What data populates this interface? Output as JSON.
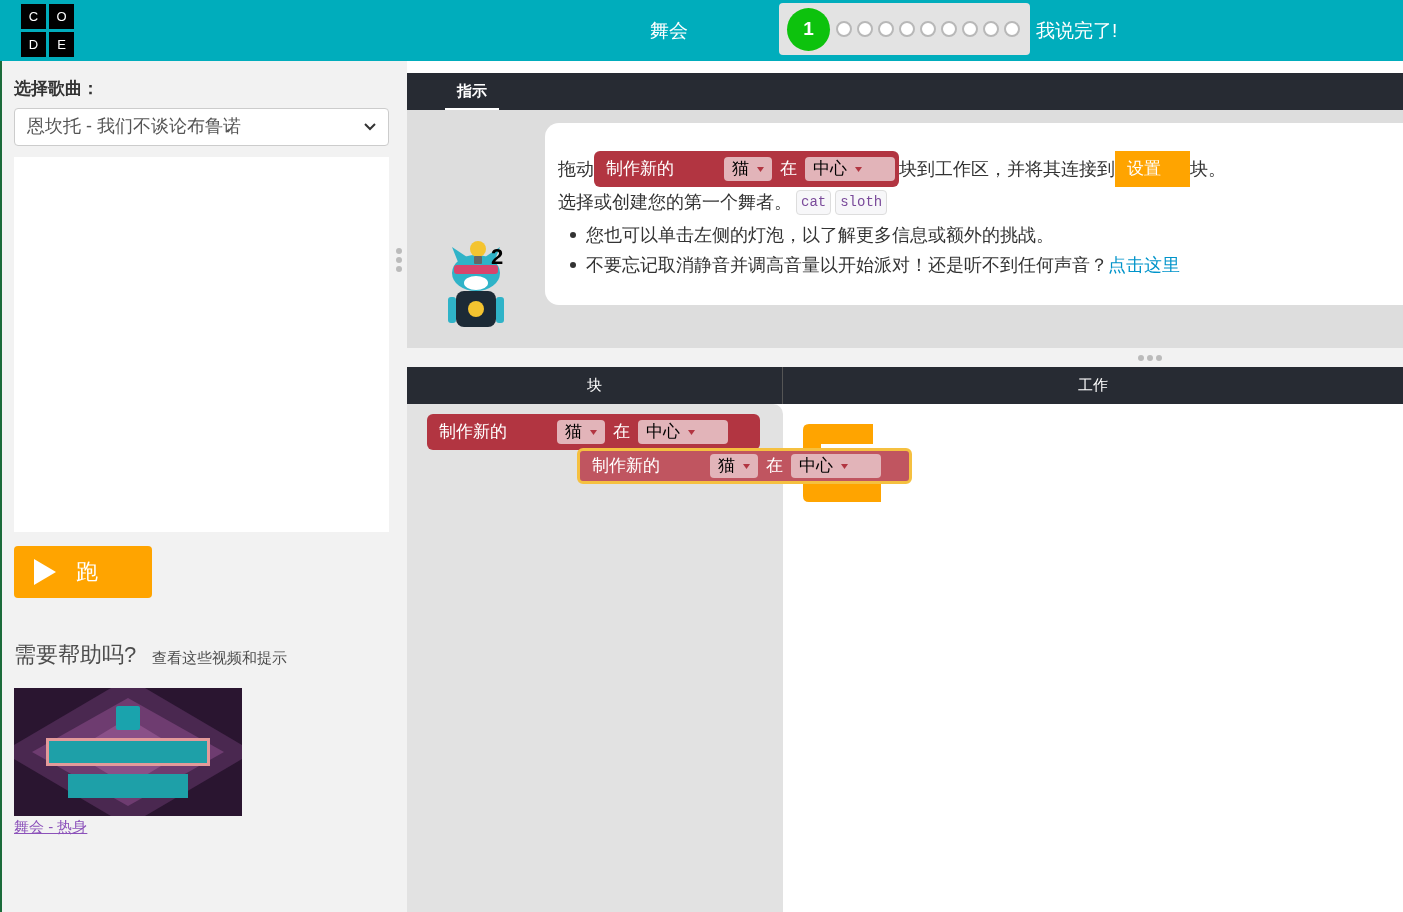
{
  "header": {
    "logo_letters": [
      "C",
      "O",
      "D",
      "E"
    ],
    "title": "舞会",
    "progress": {
      "current": "1",
      "dots": [
        {
          "completed": false
        },
        {
          "completed": false
        },
        {
          "completed": false
        },
        {
          "completed": false
        },
        {
          "completed": false
        },
        {
          "completed": false
        },
        {
          "completed": false
        },
        {
          "completed": false
        },
        {
          "completed": false
        }
      ]
    },
    "finish": "我说完了!"
  },
  "song": {
    "label": "选择歌曲：",
    "value": "恩坎托 - 我们不谈论布鲁诺"
  },
  "run_button": "跑",
  "help": {
    "title": "需要帮助吗?",
    "subtitle": "查看这些视频和提示",
    "videos": [
      {
        "kind": "picture",
        "caption": "舞会 - 热身"
      }
    ]
  },
  "instructions": {
    "tabs": [
      {
        "label": "指示",
        "selected": true
      }
    ],
    "hint_count": "2",
    "line1": [
      {
        "kind": "text",
        "text": "拖动"
      },
      {
        "kind": "block",
        "label": "制作新的",
        "field1": "猫",
        "word": "在",
        "field2": "中心"
      },
      {
        "kind": "text",
        "text": "块到工作区，并将其连接到"
      },
      {
        "kind": "setup",
        "label": "设置"
      },
      {
        "kind": "text",
        "text": "块。"
      }
    ],
    "line2": {
      "text": "选择或创建您的第一个舞者。",
      "codes": [
        "cat",
        "sloth"
      ]
    },
    "bullets": [
      {
        "text": "您也可以单击左侧的灯泡，以了解更多信息或额外的挑战。"
      },
      {
        "text": "不要忘记取消静音并调高音量以开始派对！还是听不到任何声音？",
        "link": "点击这里"
      }
    ]
  },
  "toolbox": {
    "title": "块",
    "blocks": [
      {
        "label": "制作新的",
        "field1": "猫",
        "word": "在",
        "field2": "中心"
      }
    ]
  },
  "workspace": {
    "title": "工作",
    "dragged_block": {
      "label": "制作新的",
      "field1": "猫",
      "word": "在",
      "field2": "中心"
    }
  }
}
